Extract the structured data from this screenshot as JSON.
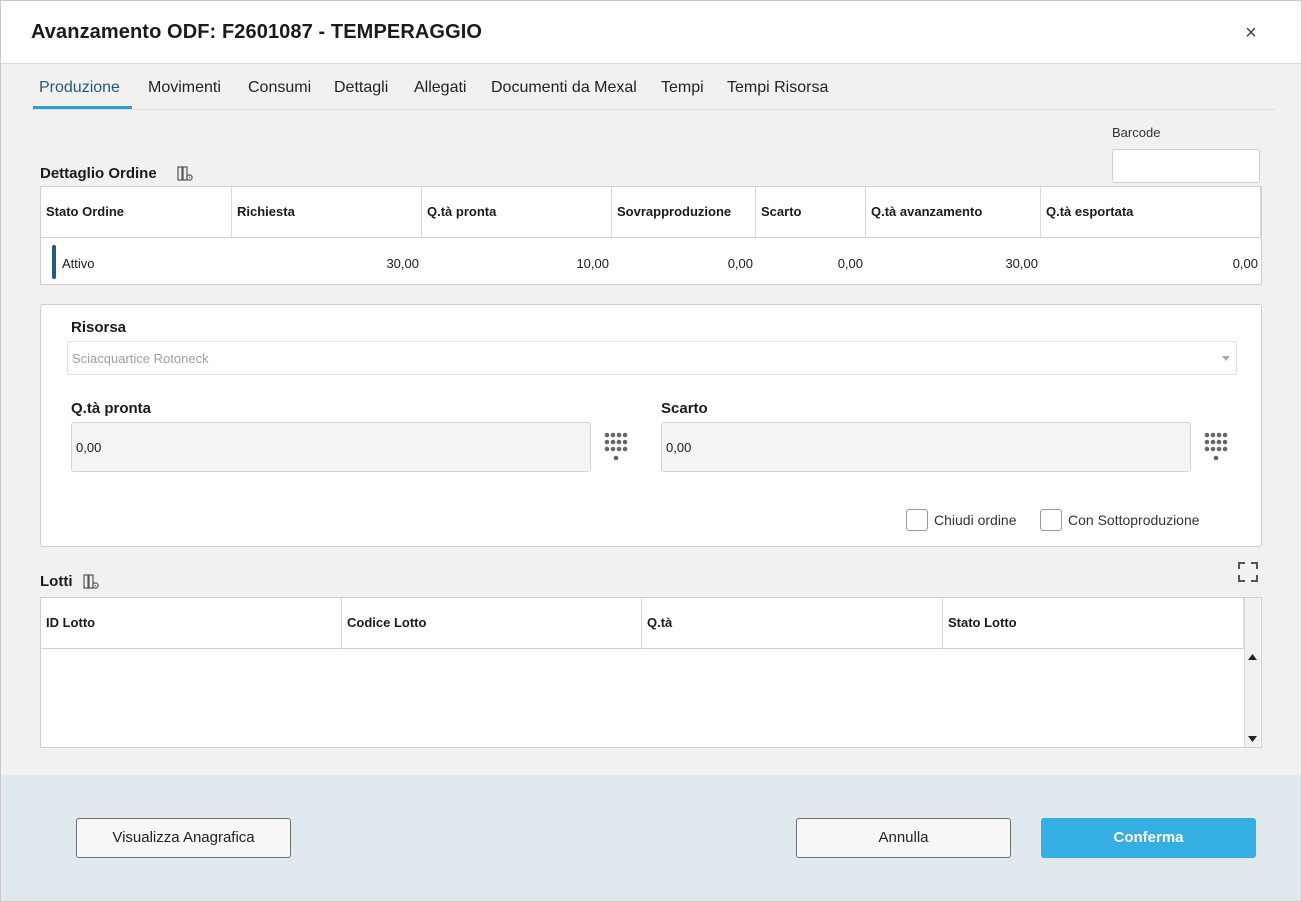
{
  "window": {
    "title": "Avanzamento ODF: F2601087 - TEMPERAGGIO",
    "close_glyph": "×"
  },
  "tabs": [
    {
      "label": "Produzione",
      "active": true
    },
    {
      "label": "Movimenti"
    },
    {
      "label": "Consumi"
    },
    {
      "label": "Dettagli"
    },
    {
      "label": "Allegati"
    },
    {
      "label": "Documenti da Mexal"
    },
    {
      "label": "Tempi"
    },
    {
      "label": "Tempi Risorsa"
    }
  ],
  "barcode": {
    "label": "Barcode",
    "value": ""
  },
  "order_detail": {
    "title": "Dettaglio Ordine",
    "columns": [
      "Stato Ordine",
      "Richiesta",
      "Q.tà pronta",
      "Sovrapproduzione",
      "Scarto",
      "Q.tà avanzamento",
      "Q.tà esportata"
    ],
    "row": {
      "status": "Attivo",
      "requested": "30,00",
      "ready": "10,00",
      "overproduction": "0,00",
      "scrap": "0,00",
      "progress": "30,00",
      "exported": "0,00"
    },
    "status_color": "#1e5c7d"
  },
  "form": {
    "resource_label": "Risorsa",
    "resource_value": "Sciacquartice Rotoneck",
    "ready_label": "Q.tà pronta",
    "ready_value": "0,00",
    "scrap_label": "Scarto",
    "scrap_value": "0,00",
    "close_order_label": "Chiudi ordine",
    "close_order_checked": false,
    "subproduction_label": "Con Sottoproduzione",
    "subproduction_checked": false
  },
  "lots": {
    "title": "Lotti",
    "columns": [
      "ID Lotto",
      "Codice Lotto",
      "Q.tà",
      "Stato Lotto"
    ],
    "rows": []
  },
  "footer": {
    "view_registry_label": "Visualizza Anagrafica",
    "cancel_label": "Annulla",
    "confirm_label": "Conferma"
  },
  "colors": {
    "accent": "#34aee3",
    "tab_underline": "#2f9fd0",
    "footer_bg": "#dfe9ee"
  }
}
